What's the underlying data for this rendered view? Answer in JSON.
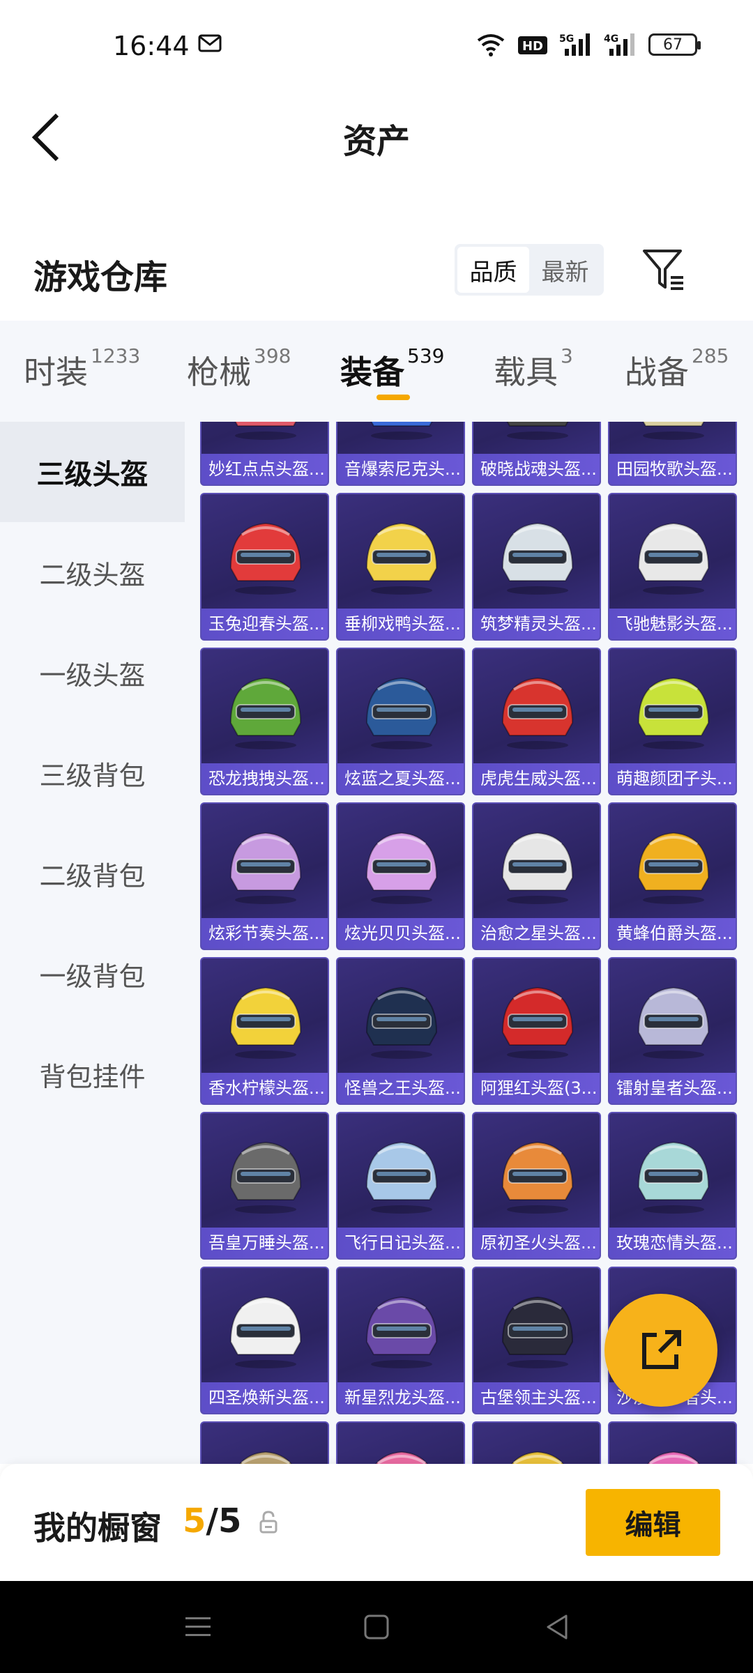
{
  "status": {
    "time": "16:44",
    "battery": "67"
  },
  "header": {
    "title": "资产"
  },
  "warehouse": {
    "title": "游戏仓库",
    "sort_options": [
      "品质",
      "最新"
    ],
    "active_sort": "品质"
  },
  "tabs": [
    {
      "label": "时装",
      "count": "1233"
    },
    {
      "label": "枪械",
      "count": "398"
    },
    {
      "label": "装备",
      "count": "539",
      "active": true
    },
    {
      "label": "载具",
      "count": "3"
    },
    {
      "label": "战备",
      "count": "285"
    }
  ],
  "sidebar": [
    {
      "label": "三级头盔",
      "active": true
    },
    {
      "label": "二级头盔"
    },
    {
      "label": "一级头盔"
    },
    {
      "label": "三级背包"
    },
    {
      "label": "二级背包"
    },
    {
      "label": "一级背包"
    },
    {
      "label": "背包挂件"
    }
  ],
  "items": [
    "妙红点点头盔...",
    "音爆索尼克头...",
    "破晓战魂头盔...",
    "田园牧歌头盔...",
    "玉兔迎春头盔...",
    "垂柳戏鸭头盔...",
    "筑梦精灵头盔...",
    "飞驰魅影头盔...",
    "恐龙拽拽头盔...",
    "炫蓝之夏头盔...",
    "虎虎生威头盔...",
    "萌趣颜团子头...",
    "炫彩节奏头盔...",
    "炫光贝贝头盔...",
    "治愈之星头盔...",
    "黄蜂伯爵头盔...",
    "香水柠檬头盔...",
    "怪兽之王头盔...",
    "阿狸红头盔(3...",
    "镭射皇者头盔...",
    "吾皇万睡头盔...",
    "飞行日记头盔...",
    "原初圣火头盔...",
    "玫瑰恋情头盔...",
    "四圣焕新头盔...",
    "新星烈龙头盔...",
    "古堡领主头盔...",
    "沙漠守护者头...",
    "",
    "",
    "",
    ""
  ],
  "item_colors": [
    "#e05a6a",
    "#3a6ad8",
    "#444444",
    "#d9cfa0",
    "#e23b3b",
    "#f2d24a",
    "#d8e0e6",
    "#e8e8e8",
    "#5fa83a",
    "#2b5a9a",
    "#d8342e",
    "#c8e23a",
    "#c79ae0",
    "#d7a0e8",
    "#e6e6e6",
    "#f0b020",
    "#f2d23a",
    "#1f3050",
    "#d42a2a",
    "#b8b8d8",
    "#6a6a6a",
    "#a8c8e8",
    "#e88a3a",
    "#a8d8d8",
    "#f0f0f0",
    "#6a4aa8",
    "#2a2a3a",
    "#d8c890",
    "#b8a070",
    "#e86aa0",
    "#e8c03a",
    "#e86ab8"
  ],
  "showcase": {
    "label": "我的橱窗",
    "current": "5",
    "total": "5",
    "edit_label": "编辑"
  },
  "accent": "#f5a800"
}
